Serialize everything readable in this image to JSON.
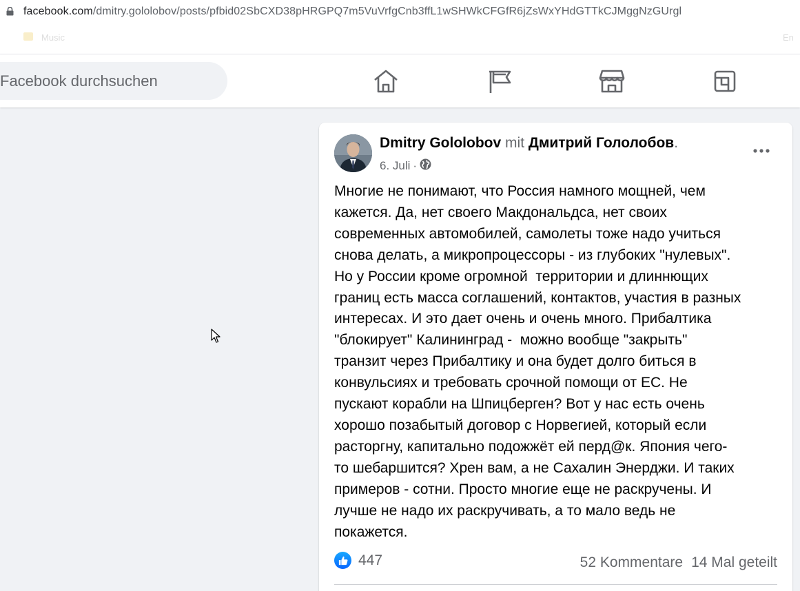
{
  "browser": {
    "url_domain": "facebook.com",
    "url_path": "/dmitry.gololobov/posts/pfbid02SbCXD38pHRGPQ7m5VuVrfgCnb3ffL1wSHWkCFGfR6jZsWxYHdGTTkCJMggNzGUrgl",
    "bookmarks": [
      "Music",
      "En"
    ]
  },
  "fb_header": {
    "search_placeholder": "Facebook durchsuchen",
    "nav_icons": [
      "home-icon",
      "flag-icon",
      "marketplace-icon",
      "gaming-icon"
    ]
  },
  "post": {
    "author": "Dmitry Gololobov",
    "with_word": "mit",
    "tagged": "Дмитрий Гололобов",
    "tagged_suffix": ".",
    "date": "6. Juli",
    "separator": "·",
    "privacy_icon": "globe-icon",
    "text": "Многие не понимают, что Россия намного мощней, чем\nкажется. Да, нет своего Макдональдса, нет своих\nсовременных автомобилей, самолеты тоже надо учиться\nснова делать, а микропроцессоры - из глубоких \"нулевых\".\nНо у России кроме огромной  территории и длиннющих\nграниц есть масса соглашений, контактов, участия в разных\nинтересах. И это дает очень и очень много. Прибалтика\n\"блокирует\" Калининград -  можно вообще \"закрыть\"\nтранзит через Прибалтику и она будет долго биться в\nконвульсиях и требовать срочной помощи от ЕС. Не\nпускают корабли на Шпицберген? Вот у нас есть очень\nхорошо позабытый договор с Норвегией, который если\nрасторгну, капитально подожжёт ей перд@к. Япония чего-\nто шебаршится? Хрен вам, а не Сахалин Энерджи. И таких\nпримеров - сотни. Просто многие еще не раскручены. И\nлучше не надо их раскручивать, а то мало ведь не\nпокажется.",
    "reaction_count": "447",
    "comments": "52 Kommentare",
    "shares": "14 Mal geteilt"
  },
  "colors": {
    "fb_blue": "#0866ff",
    "background": "#f0f2f5",
    "secondary_text": "#65676b"
  }
}
